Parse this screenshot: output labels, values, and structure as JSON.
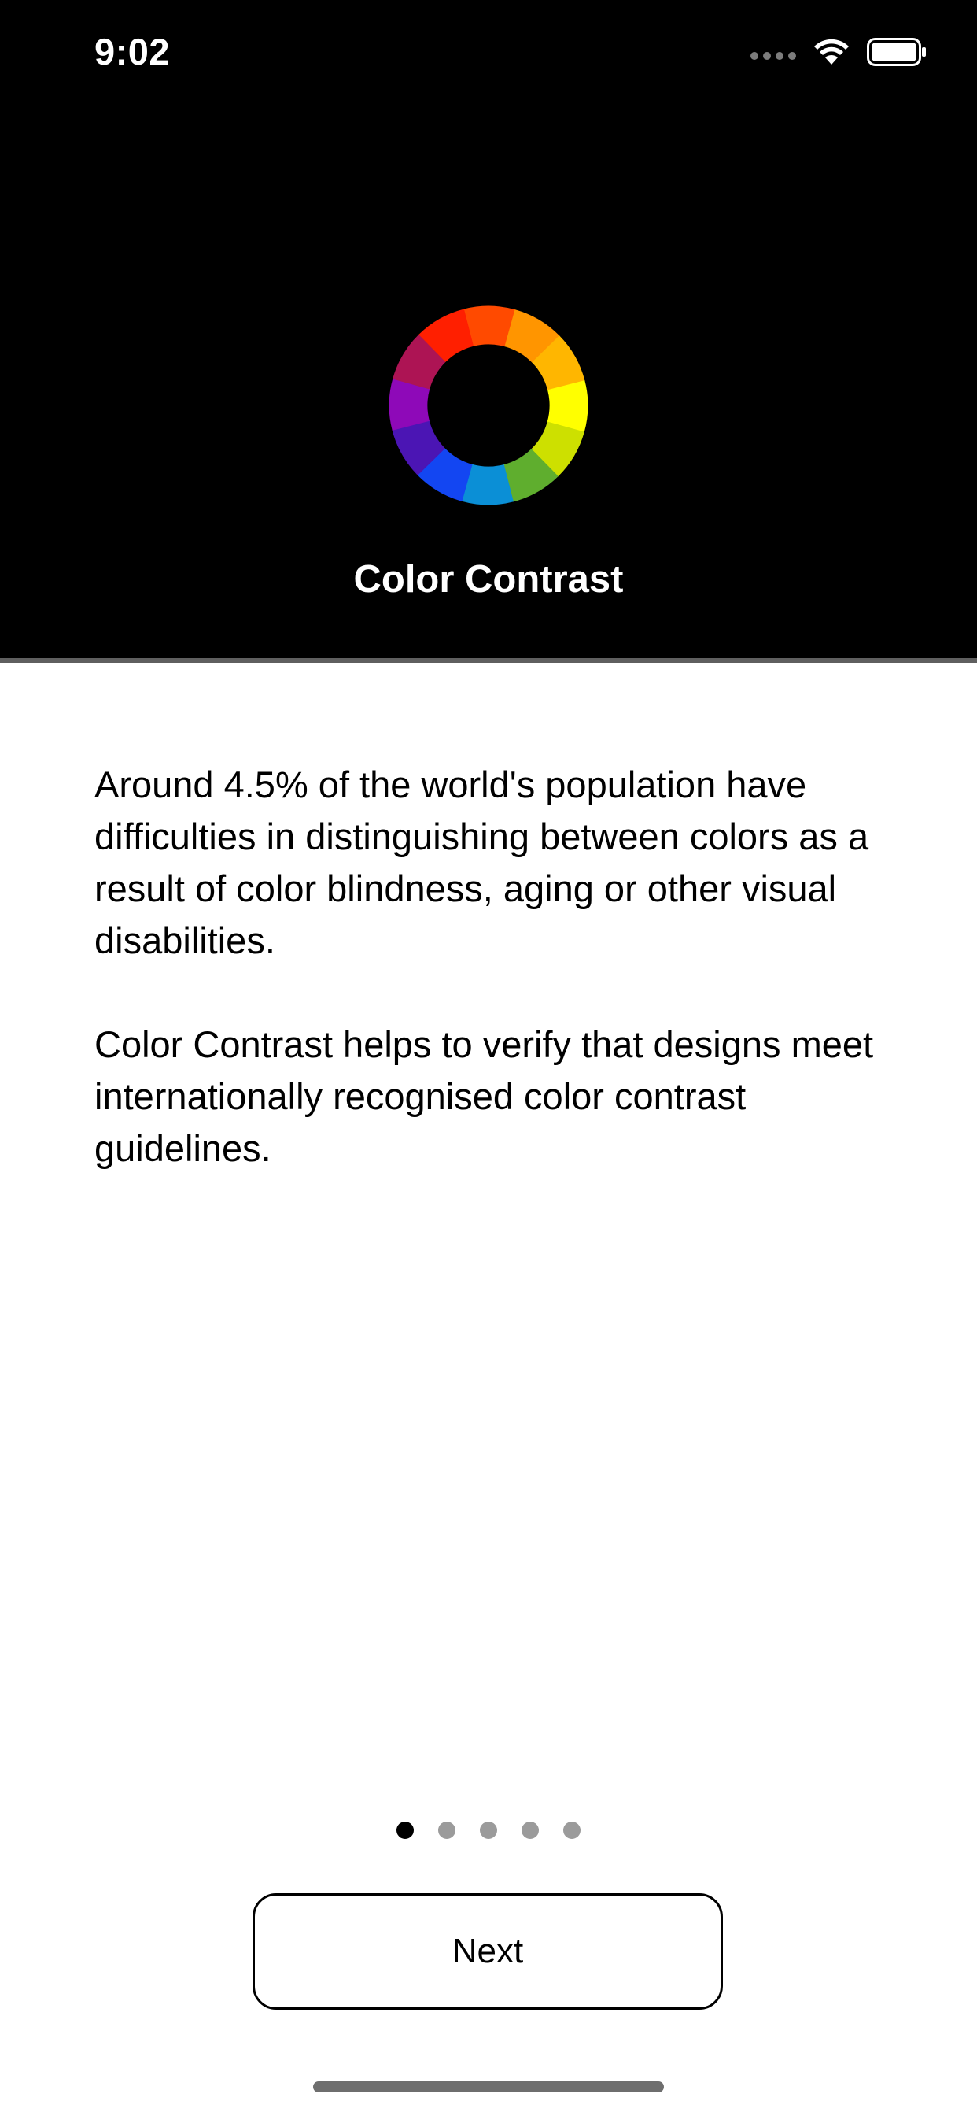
{
  "status_bar": {
    "time": "9:02",
    "icons": [
      "cellular-signal-icon",
      "wifi-icon",
      "battery-icon"
    ]
  },
  "header": {
    "logo_icon": "color-wheel-icon",
    "title": "Color Contrast"
  },
  "content": {
    "paragraphs": [
      "Around 4.5% of the world's population have difficulties in distinguishing between colors as a result of color blindness, aging or other visual disabilities.",
      "Color Contrast helps to verify that designs meet internationally recognised color contrast guidelines."
    ]
  },
  "pager": {
    "total_pages": 5,
    "current_page": 1
  },
  "actions": {
    "next_label": "Next"
  },
  "colors": {
    "header_background": "#000000",
    "page_background": "#ffffff",
    "wheel": [
      "#ff4a00",
      "#ff9500",
      "#ffb600",
      "#ffff00",
      "#cde000",
      "#5fae2e",
      "#0b8fd6",
      "#1346f2",
      "#4b15b4",
      "#8e09b8",
      "#ad1454",
      "#ff1f00"
    ]
  }
}
